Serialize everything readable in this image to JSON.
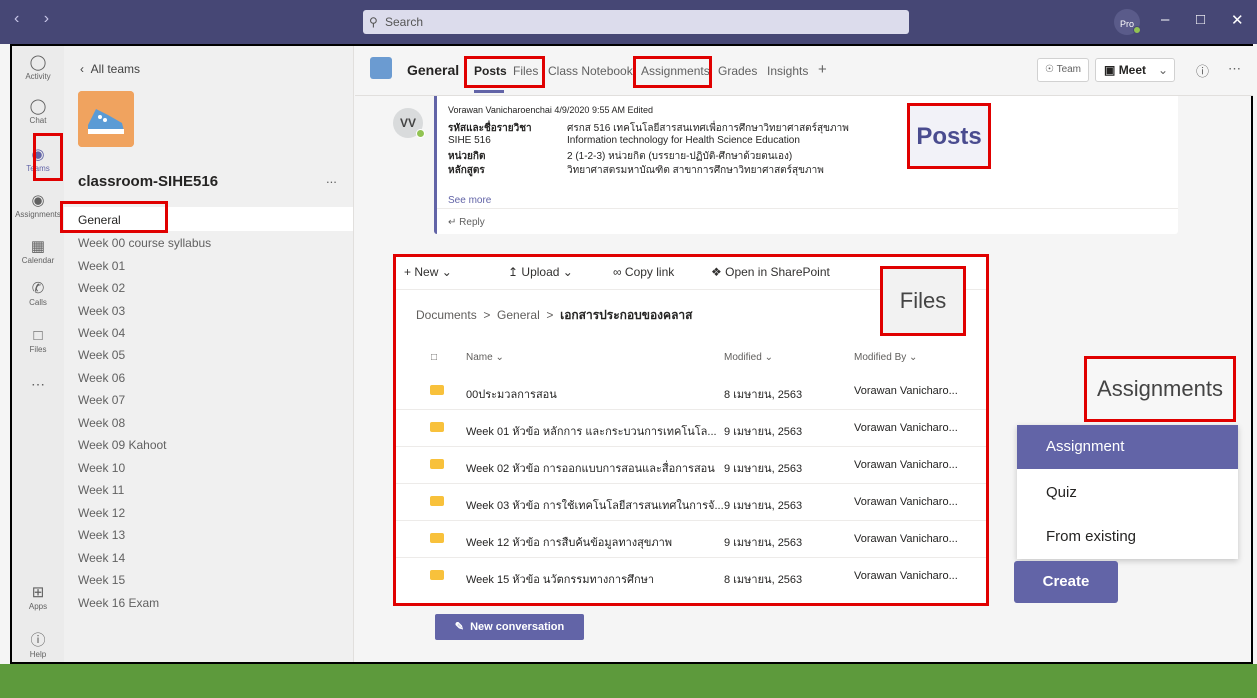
{
  "titlebar": {
    "search_placeholder": "Search",
    "avatar_label": "Pro"
  },
  "rail": [
    {
      "label": "Activity",
      "icon": "bell-icon"
    },
    {
      "label": "Chat",
      "icon": "chat-icon"
    },
    {
      "label": "Teams",
      "icon": "teams-icon"
    },
    {
      "label": "Assignments",
      "icon": "assignments-icon"
    },
    {
      "label": "Calendar",
      "icon": "calendar-icon"
    },
    {
      "label": "Calls",
      "icon": "phone-icon"
    },
    {
      "label": "Files",
      "icon": "file-icon"
    },
    {
      "label": "Apps",
      "icon": "apps-icon"
    },
    {
      "label": "Help",
      "icon": "help-icon"
    }
  ],
  "team": {
    "back_label": "All teams",
    "name": "classroom-SIHE516",
    "more": "...",
    "channels": [
      "General",
      "Week 00 course syllabus",
      "Week 01",
      "Week 02",
      "Week 03",
      "Week 04",
      "Week 05",
      "Week 06",
      "Week 07",
      "Week 08",
      "Week 09 Kahoot",
      "Week 10",
      "Week 11",
      "Week 12",
      "Week 13",
      "Week 14",
      "Week 15",
      "Week 16 Exam"
    ]
  },
  "header": {
    "title": "General",
    "tabs": [
      "Posts",
      "Files",
      "Class Notebook",
      "Assignments",
      "Grades",
      "Insights",
      "+"
    ],
    "team_chip": "Team",
    "meet_label": "Meet"
  },
  "post": {
    "initials": "VV",
    "meta": "Vorawan Vanicharoenchai  4/9/2020 9:55 AM  Edited",
    "rows": [
      {
        "key": "รหัสและชื่อรายวิชา",
        "value": "ศรกส 516  เทคโนโลยีสารสนเทศเพื่อการศึกษาวิทยาศาสตร์สุขภาพ"
      },
      {
        "key": "SIHE 516",
        "value": "Information technology for Health Science Education"
      },
      {
        "key": "หน่วยกิต",
        "value": "2 (1-2-3) หน่วยกิต (บรรยาย-ปฏิบัติ-ศึกษาด้วยตนเอง)"
      },
      {
        "key": "หลักสูตร",
        "value": "วิทยาศาสตรมหาบัณฑิต สาขาการศึกษาวิทยาศาสตร์สุขภาพ"
      }
    ],
    "see_more": "See more",
    "reply": "Reply"
  },
  "callouts": {
    "posts": "Posts",
    "files": "Files",
    "assignments": "Assignments"
  },
  "files": {
    "toolbar": {
      "new": "New",
      "upload": "Upload",
      "copy_link": "Copy link",
      "open_sharepoint": "Open in SharePoint"
    },
    "breadcrumb": [
      "Documents",
      "General",
      "เอกสารประกอบของคลาส"
    ],
    "columns": [
      "Name",
      "Modified",
      "Modified By"
    ],
    "rows": [
      {
        "name": "00ประมวลการสอน",
        "modified": "8 เมษายน, 2563",
        "by": "Vorawan Vanicharo..."
      },
      {
        "name": "Week 01 หัวข้อ หลักการ และกระบวนการเทคโนโล...",
        "modified": "9 เมษายน, 2563",
        "by": "Vorawan Vanicharo..."
      },
      {
        "name": "Week 02 หัวข้อ การออกแบบการสอนและสื่อการสอน",
        "modified": "9 เมษายน, 2563",
        "by": "Vorawan Vanicharo..."
      },
      {
        "name": "Week 03 หัวข้อ การใช้เทคโนโลยีสารสนเทศในการจั...",
        "modified": "9 เมษายน, 2563",
        "by": "Vorawan Vanicharo..."
      },
      {
        "name": "Week 12 หัวข้อ การสืบค้นข้อมูลทางสุขภาพ",
        "modified": "9 เมษายน, 2563",
        "by": "Vorawan Vanicharo..."
      },
      {
        "name": "Week 15 หัวข้อ นวัตกรรมทางการศึกษา",
        "modified": "8 เมษายน, 2563",
        "by": "Vorawan Vanicharo..."
      }
    ]
  },
  "new_conversation": "New conversation",
  "assign_menu": [
    "Assignment",
    "Quiz",
    "From existing"
  ],
  "create_label": "Create"
}
